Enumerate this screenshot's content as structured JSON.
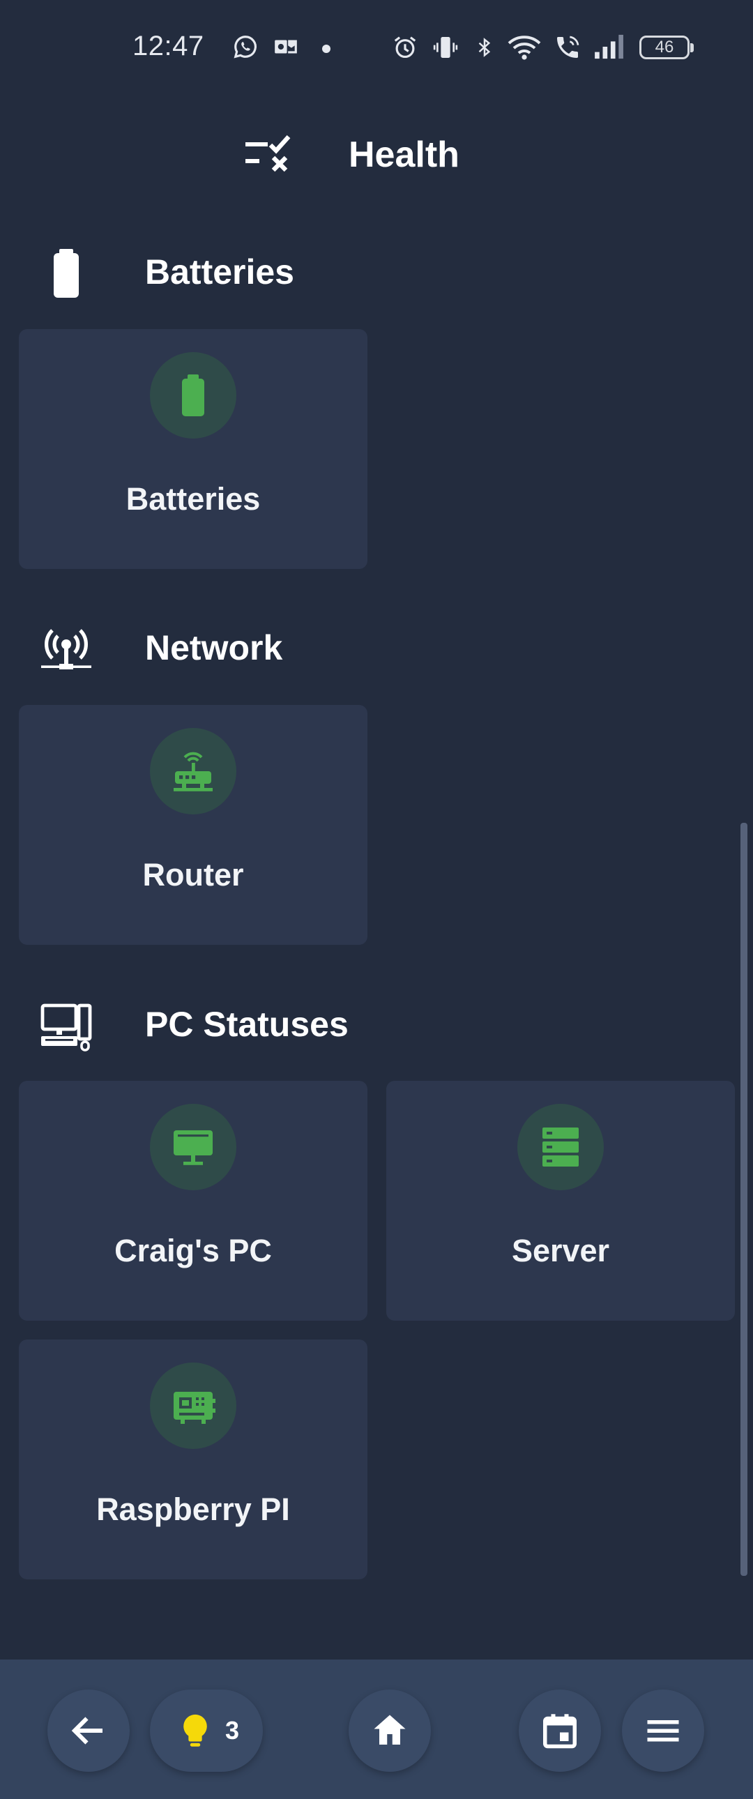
{
  "status_bar": {
    "time": "12:47",
    "battery": "46",
    "icons": [
      "whatsapp-icon",
      "outlook-icon",
      "dot-icon",
      "alarm-icon",
      "vibrate-icon",
      "bluetooth-icon",
      "wifi-icon",
      "wifi-call-icon",
      "signal-icon",
      "battery-icon"
    ]
  },
  "header": {
    "title": "Health",
    "icon": "checklist-icon"
  },
  "sections": [
    {
      "title": "Batteries",
      "icon": "battery-icon",
      "cards": [
        {
          "label": "Batteries",
          "icon": "battery-icon"
        }
      ]
    },
    {
      "title": "Network",
      "icon": "network-wireless-icon",
      "cards": [
        {
          "label": "Router",
          "icon": "router-icon"
        }
      ]
    },
    {
      "title": "PC Statuses",
      "icon": "desktop-classic-icon",
      "cards": [
        {
          "label": "Craig's PC",
          "icon": "monitor-icon"
        },
        {
          "label": "Server",
          "icon": "server-icon"
        },
        {
          "label": "Raspberry PI",
          "icon": "chip-icon"
        }
      ]
    }
  ],
  "bottom_nav": {
    "lights_count": "3",
    "items": [
      "back-icon",
      "lightbulb-icon",
      "home-icon",
      "calendar-icon",
      "menu-icon"
    ]
  },
  "colors": {
    "background": "#232c3e",
    "card": "#2d374e",
    "icon_circle": "#2f4b49",
    "accent_green": "#4caf50",
    "bulb_yellow": "#f5d90a",
    "bottom_bar": "#34445e"
  }
}
